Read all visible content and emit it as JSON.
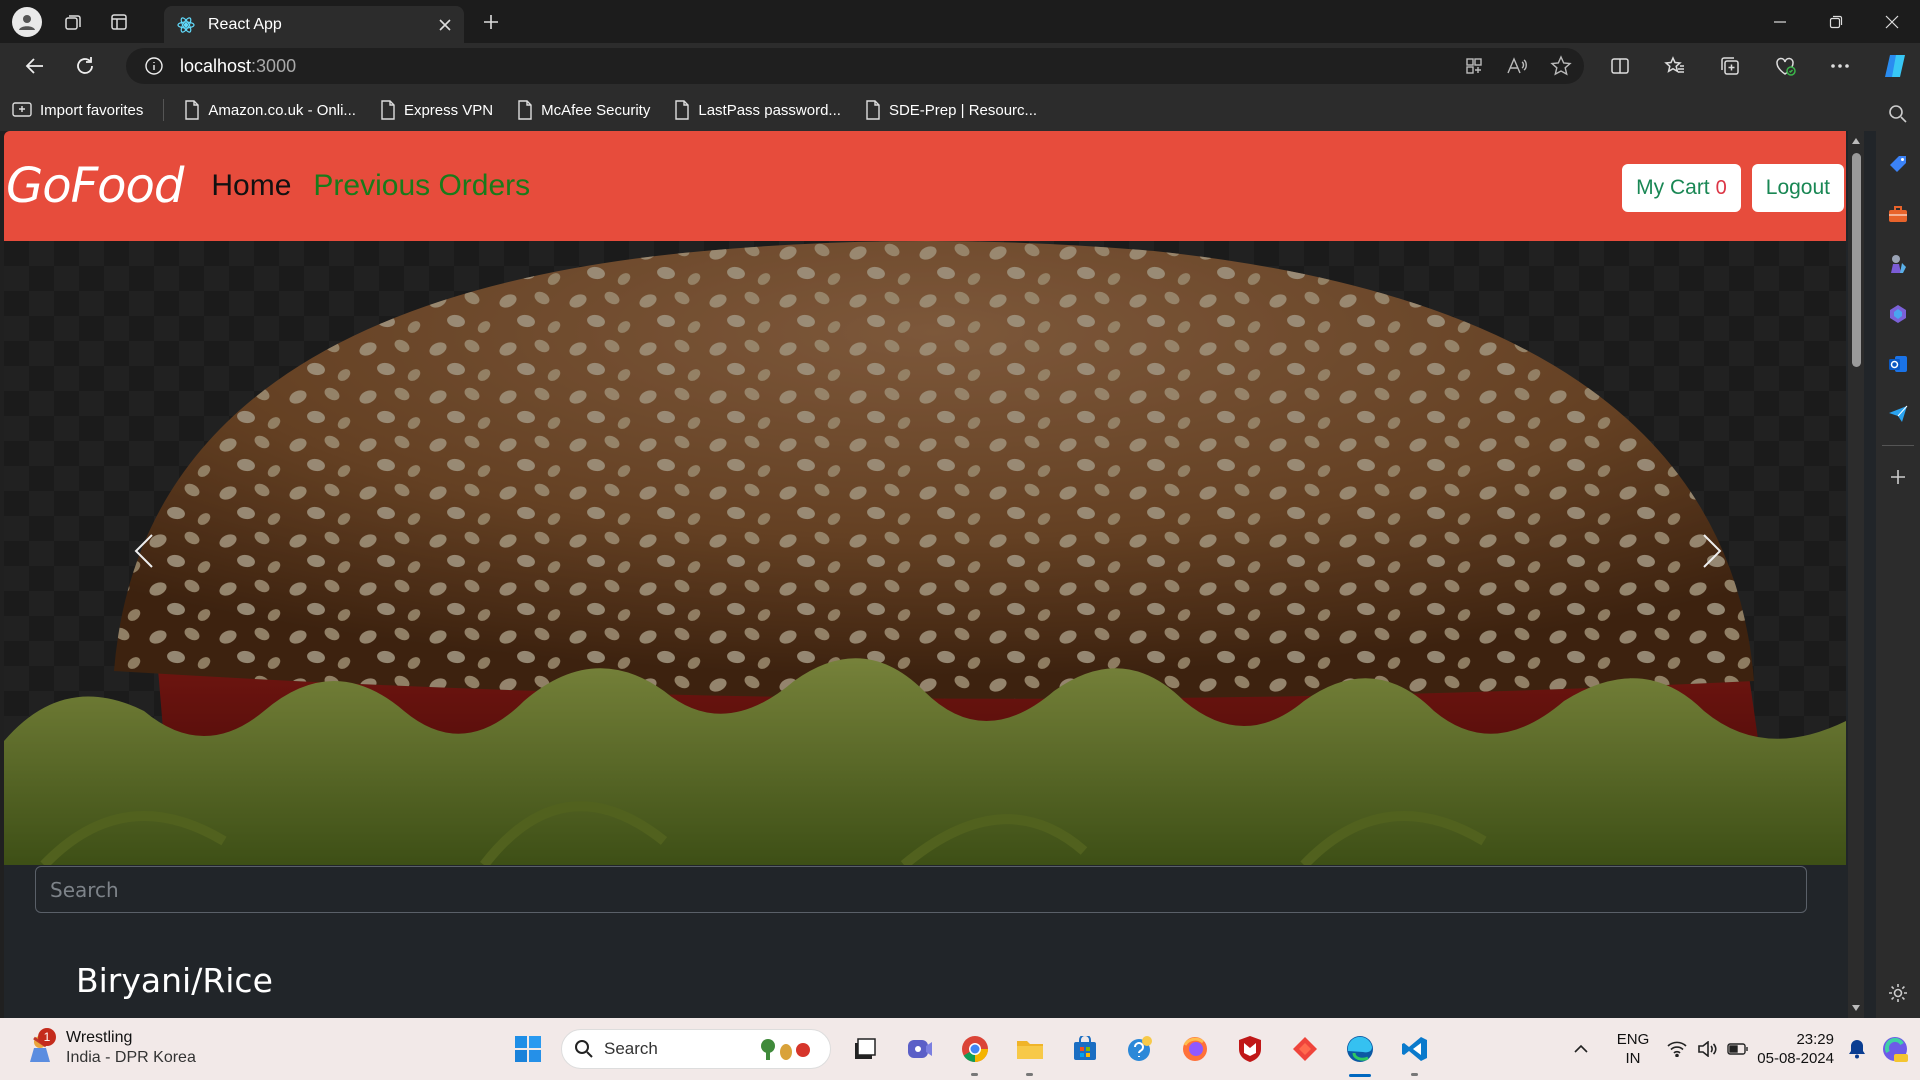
{
  "browser": {
    "tab": {
      "title": "React App"
    },
    "address": {
      "host": "localhost",
      "port": ":3000"
    },
    "bookmarks": [
      {
        "label": "Import favorites"
      },
      {
        "label": "Amazon.co.uk - Onli..."
      },
      {
        "label": "Express VPN"
      },
      {
        "label": "McAfee Security"
      },
      {
        "label": "LastPass password..."
      },
      {
        "label": "SDE-Prep | Resourc..."
      }
    ]
  },
  "app": {
    "brand": "GoFood",
    "nav": {
      "home": "Home",
      "previous_orders": "Previous Orders"
    },
    "cart": {
      "label": "My Cart",
      "count": "0"
    },
    "logout": "Logout",
    "search": {
      "placeholder": "Search"
    },
    "category_title": "Biryani/Rice",
    "colors": {
      "navbar": "#e74c3c",
      "nav_link": "#1a7a1a",
      "button_text": "#198754",
      "badge": "#dc3545"
    }
  },
  "taskbar": {
    "weather": {
      "title": "Wrestling",
      "subtitle": "India - DPR Korea",
      "badge": "1"
    },
    "search_label": "Search",
    "tray": {
      "lang_line1": "ENG",
      "lang_line2": "IN",
      "time": "23:29",
      "date": "05-08-2024"
    }
  }
}
